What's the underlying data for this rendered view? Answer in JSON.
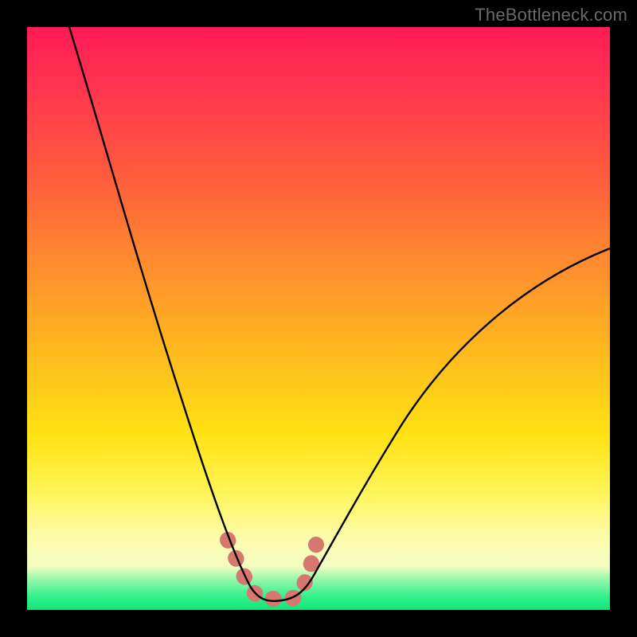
{
  "watermark": {
    "text": "TheBottleneck.com"
  },
  "chart_data": {
    "type": "line",
    "title": "",
    "xlabel": "",
    "ylabel": "",
    "xlim": [
      0,
      100
    ],
    "ylim": [
      0,
      100
    ],
    "series": [
      {
        "name": "bottleneck-curve",
        "x": [
          7,
          10,
          14,
          18,
          22,
          26,
          30,
          33,
          35,
          37,
          38.5,
          40,
          42,
          44,
          46,
          48,
          52,
          58,
          66,
          76,
          88,
          100
        ],
        "y": [
          100,
          88,
          74,
          60,
          46,
          32,
          20,
          12,
          7,
          3.5,
          2.2,
          2,
          2,
          2.2,
          3.2,
          5,
          9,
          16,
          26,
          38,
          50,
          62
        ]
      }
    ],
    "annotations": [
      {
        "name": "valley-marker",
        "shape": "rounded-U",
        "color": "#d6786f",
        "x_range": [
          34.5,
          46.5
        ],
        "y_range": [
          2,
          12
        ]
      }
    ],
    "background_gradient": {
      "stops": [
        {
          "pos": 0.0,
          "color": "#ff1a55"
        },
        {
          "pos": 0.4,
          "color": "#ff8a2f"
        },
        {
          "pos": 0.7,
          "color": "#ffe213"
        },
        {
          "pos": 0.9,
          "color": "#fcfcb0"
        },
        {
          "pos": 0.97,
          "color": "#2cf08a"
        },
        {
          "pos": 1.0,
          "color": "#14e37a"
        }
      ]
    }
  },
  "colors": {
    "curve": "#000000",
    "marker": "#d6786f",
    "frame": "#000000"
  }
}
